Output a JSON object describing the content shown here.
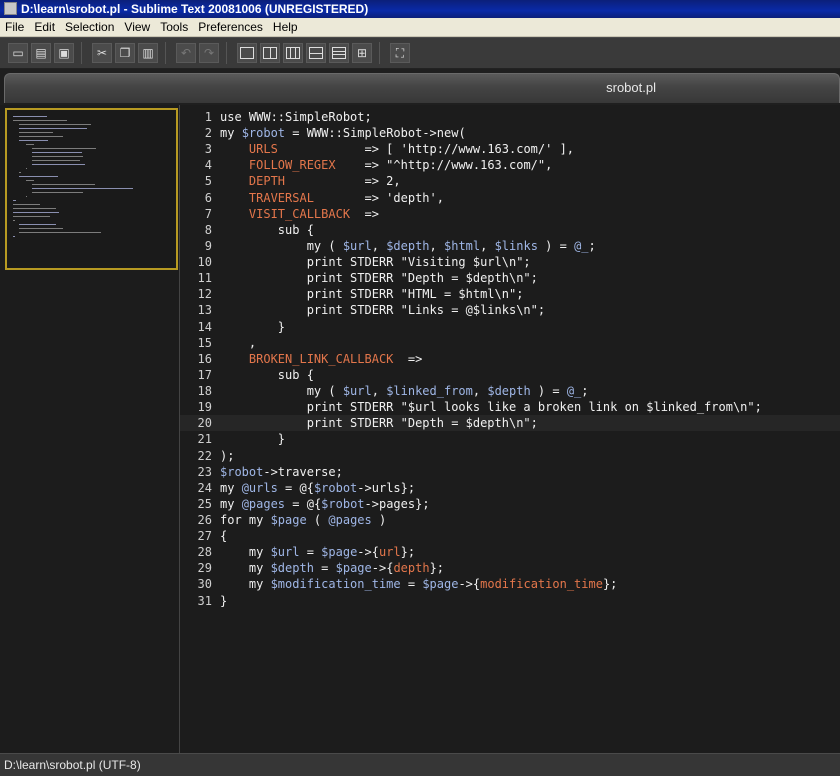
{
  "window": {
    "title": "D:\\learn\\srobot.pl - Sublime Text 20081006 (UNREGISTERED)"
  },
  "menu": [
    "File",
    "Edit",
    "Selection",
    "View",
    "Tools",
    "Preferences",
    "Help"
  ],
  "toolbar": {
    "buttons": [
      "new-file-icon",
      "open-file-icon",
      "save-icon",
      "cut-icon",
      "copy-icon",
      "paste-icon",
      "undo-icon",
      "redo-icon",
      "layout-single-icon",
      "layout-two-columns-icon",
      "layout-three-columns-icon",
      "layout-two-rows-icon",
      "layout-three-rows-icon",
      "layout-grid-icon",
      "fullscreen-icon"
    ]
  },
  "tab": {
    "label": "srobot.pl"
  },
  "editor": {
    "current_line": 20,
    "lines": [
      "use WWW::SimpleRobot;",
      "my $robot = WWW::SimpleRobot->new(",
      "    URLS            => [ 'http://www.163.com/' ],",
      "    FOLLOW_REGEX    => \"^http://www.163.com/\",",
      "    DEPTH           => 2,",
      "    TRAVERSAL       => 'depth',",
      "    VISIT_CALLBACK  =>",
      "        sub {",
      "            my ( $url, $depth, $html, $links ) = @_;",
      "            print STDERR \"Visiting $url\\n\";",
      "            print STDERR \"Depth = $depth\\n\";",
      "            print STDERR \"HTML = $html\\n\";",
      "            print STDERR \"Links = @$links\\n\";",
      "        }",
      "    ,",
      "    BROKEN_LINK_CALLBACK  =>",
      "        sub {",
      "            my ( $url, $linked_from, $depth ) = @_;",
      "            print STDERR \"$url looks like a broken link on $linked_from\\n\";",
      "            print STDERR \"Depth = $depth\\n\";",
      "        }",
      ");",
      "$robot->traverse;",
      "my @urls = @{$robot->urls};",
      "my @pages = @{$robot->pages};",
      "for my $page ( @pages )",
      "{",
      "    my $url = $page->{url};",
      "    my $depth = $page->{depth};",
      "    my $modification_time = $page->{modification_time};",
      "}"
    ]
  },
  "status": {
    "text": "D:\\learn\\srobot.pl (UTF-8)"
  },
  "colors": {
    "minimap_border": "#b79a22",
    "hash_key": "#e3764b",
    "variable": "#9fb6e6",
    "title_bar": "#0a2aa8"
  }
}
